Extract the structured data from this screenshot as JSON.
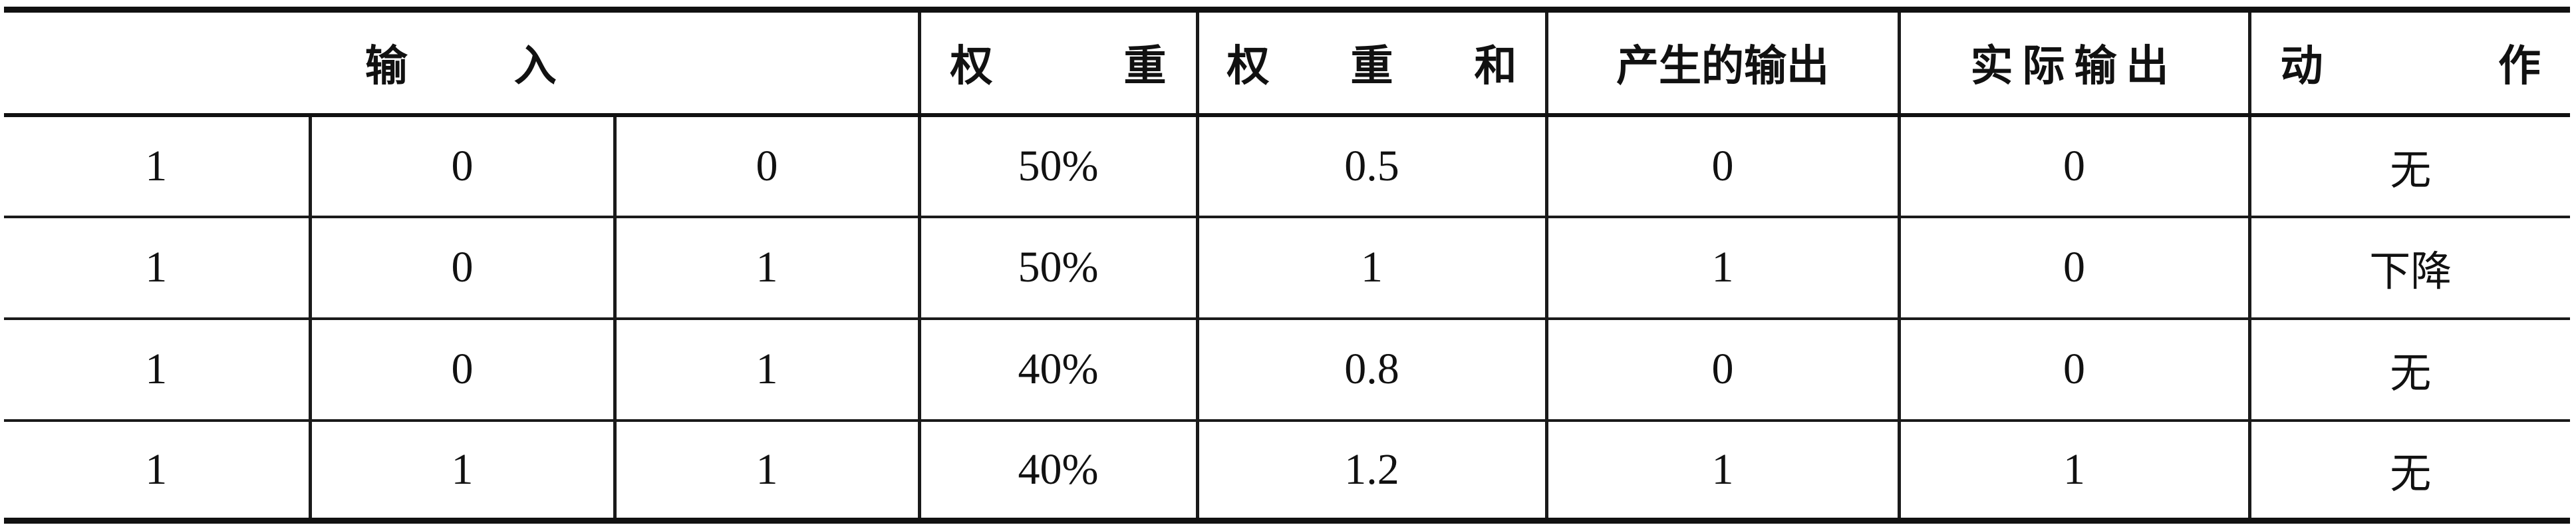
{
  "table": {
    "headers": {
      "input": "输 入",
      "weight": "权 重",
      "weight_sum": "权 重 和",
      "produced_output": "产生的输出",
      "actual_output": "实际输出",
      "action": "动 作"
    },
    "header_chars": {
      "input": [
        "输",
        "入"
      ],
      "weight": [
        "权",
        "重"
      ],
      "weight_sum": [
        "权",
        "重",
        "和"
      ],
      "action": [
        "动",
        "作"
      ]
    },
    "rows": [
      {
        "in1": "1",
        "in2": "0",
        "in3": "0",
        "weight": "50%",
        "weight_sum": "0.5",
        "produced": "0",
        "actual": "0",
        "action": "无"
      },
      {
        "in1": "1",
        "in2": "0",
        "in3": "1",
        "weight": "50%",
        "weight_sum": "1",
        "produced": "1",
        "actual": "0",
        "action": "下降"
      },
      {
        "in1": "1",
        "in2": "0",
        "in3": "1",
        "weight": "40%",
        "weight_sum": "0.8",
        "produced": "0",
        "actual": "0",
        "action": "无"
      },
      {
        "in1": "1",
        "in2": "1",
        "in3": "1",
        "weight": "40%",
        "weight_sum": "1.2",
        "produced": "1",
        "actual": "1",
        "action": "无"
      }
    ]
  }
}
